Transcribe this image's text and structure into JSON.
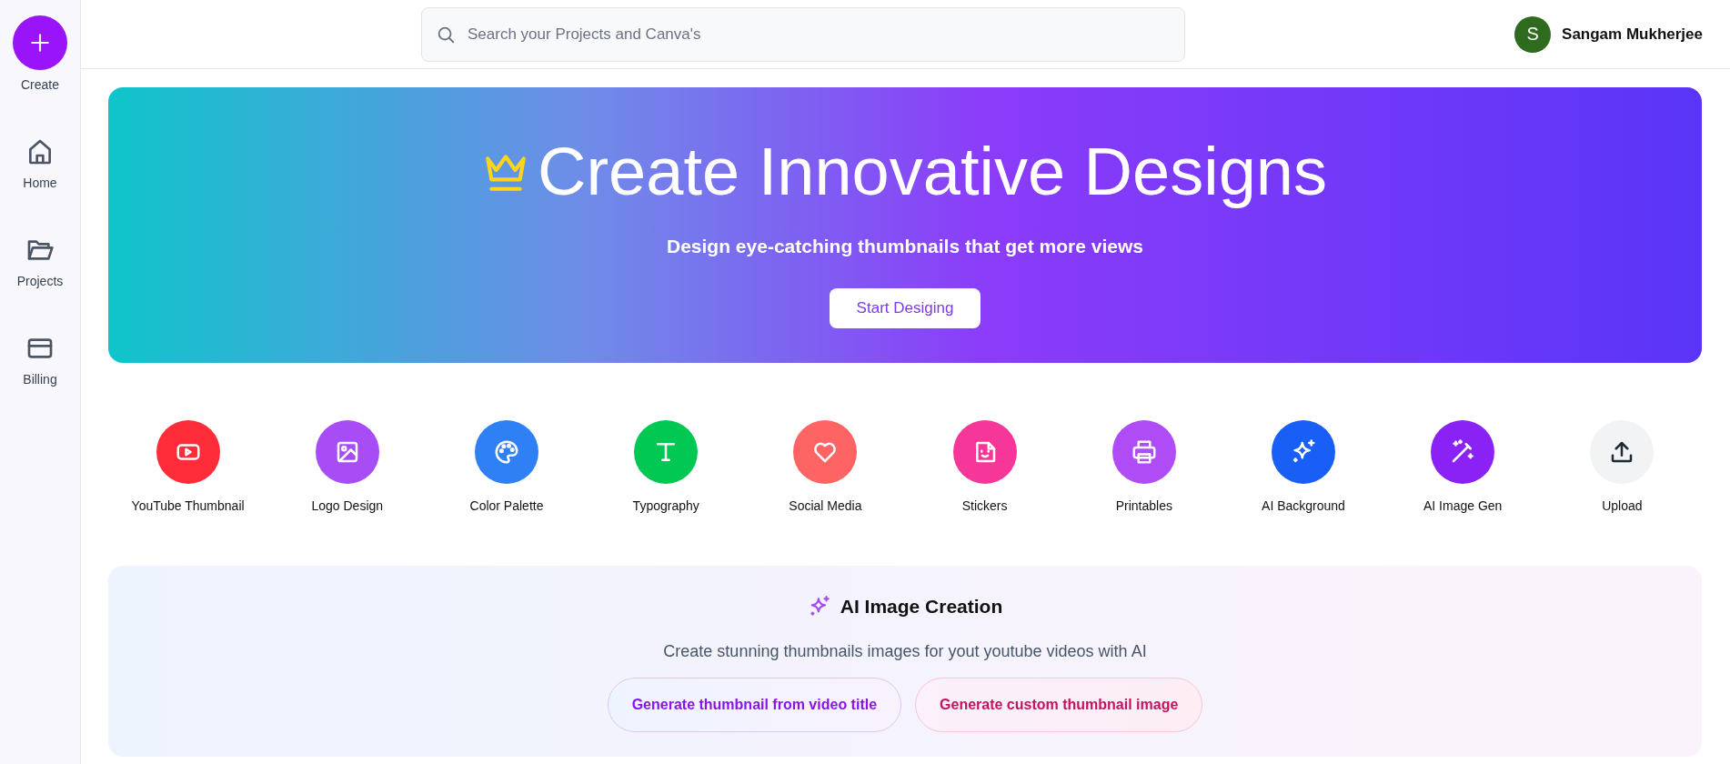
{
  "sidebar": {
    "create": {
      "label": "Create"
    },
    "items": [
      {
        "label": "Home",
        "kind": "home"
      },
      {
        "label": "Projects",
        "kind": "folder"
      },
      {
        "label": "Billing",
        "kind": "card"
      }
    ]
  },
  "search": {
    "placeholder": "Search your Projects and Canva's"
  },
  "user": {
    "initial": "S",
    "name": "Sangam Mukherjee"
  },
  "hero": {
    "title": "Create Innovative Designs",
    "subtitle": "Design eye-catching thumbnails that get more views",
    "button": "Start Desiging"
  },
  "tools": [
    {
      "label": "YouTube Thumbnail",
      "kind": "youtube",
      "color": "#ff2d3a"
    },
    {
      "label": "Logo Design",
      "kind": "image",
      "color": "#a84cf5"
    },
    {
      "label": "Color Palette",
      "kind": "palette",
      "color": "#2f7ff5"
    },
    {
      "label": "Typography",
      "kind": "type",
      "color": "#00c853"
    },
    {
      "label": "Social Media",
      "kind": "heart",
      "color": "#ff6464"
    },
    {
      "label": "Stickers",
      "kind": "sticker",
      "color": "#f7369a"
    },
    {
      "label": "Printables",
      "kind": "printer",
      "color": "#b04cf5"
    },
    {
      "label": "AI Background",
      "kind": "sparkles",
      "color": "#1a5ff5"
    },
    {
      "label": "AI Image Gen",
      "kind": "wand",
      "color": "#8a22f5"
    },
    {
      "label": "Upload",
      "kind": "upload",
      "color": "#f1f3f5"
    }
  ],
  "ai_section": {
    "title": "AI Image Creation",
    "subtitle": "Create stunning thumbnails images for yout youtube videos with AI",
    "buttons": [
      {
        "label": "Generate thumbnail from video title",
        "kind": "purple"
      },
      {
        "label": "Generate custom thumbnail image",
        "kind": "pink"
      }
    ]
  }
}
